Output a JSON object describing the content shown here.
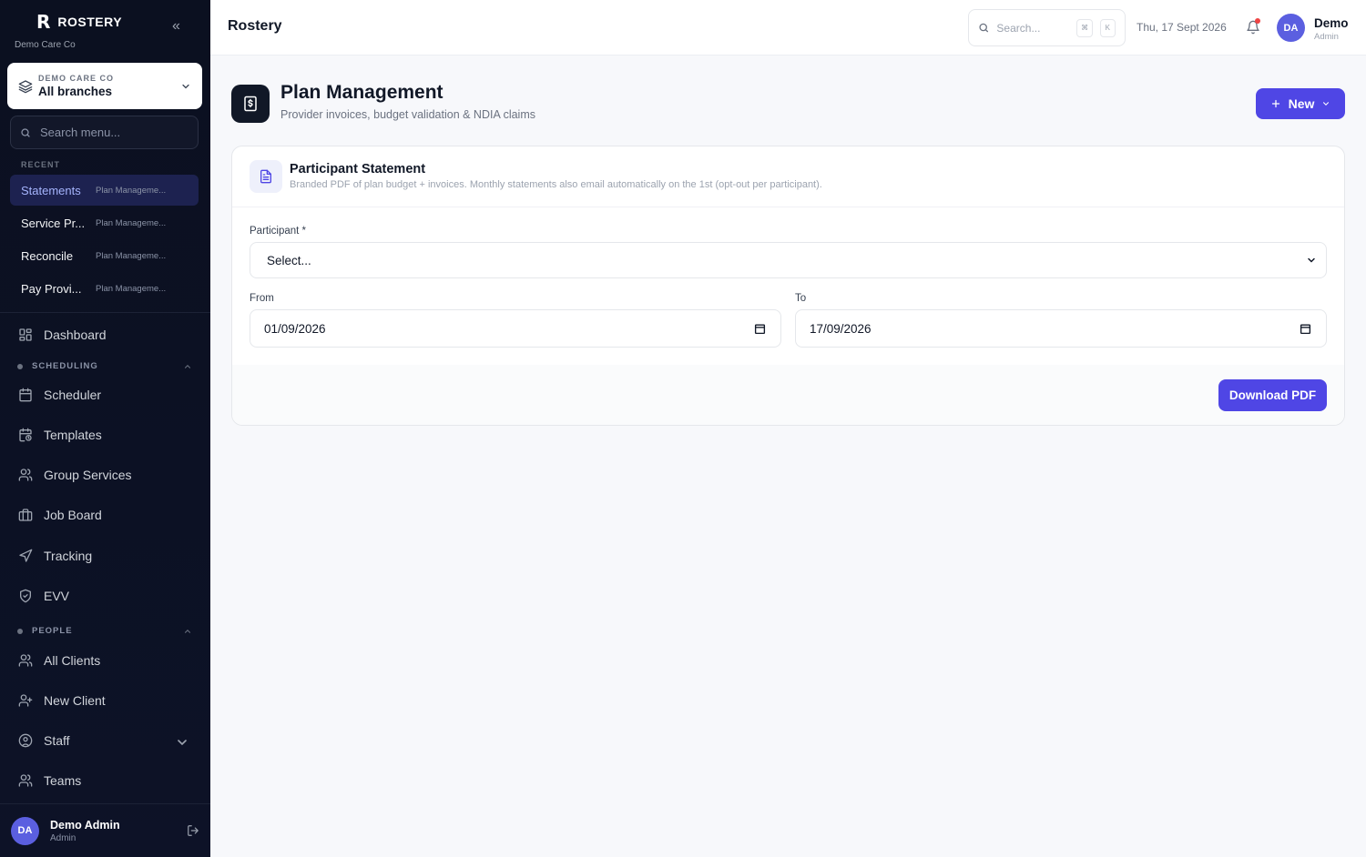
{
  "sidebar": {
    "brand": "ROSTERY",
    "brand_logo": "R",
    "collapse_icon": "«",
    "org_sub": "Demo Care Co",
    "branch": {
      "org": "DEMO CARE CO",
      "name": "All branches"
    },
    "search_placeholder": "Search menu...",
    "recent_label": "RECENT",
    "recent": [
      {
        "title": "Statements",
        "sub": "Plan Manageme..."
      },
      {
        "title": "Service Pr...",
        "sub": "Plan Manageme..."
      },
      {
        "title": "Reconcile",
        "sub": "Plan Manageme..."
      },
      {
        "title": "Pay Provi...",
        "sub": "Plan Manageme..."
      }
    ],
    "nav": {
      "dashboard": "Dashboard",
      "scheduling_label": "SCHEDULING",
      "scheduler": "Scheduler",
      "templates": "Templates",
      "group_services": "Group Services",
      "job_board": "Job Board",
      "tracking": "Tracking",
      "evv": "EVV",
      "people_label": "PEOPLE",
      "all_clients": "All Clients",
      "new_client": "New Client",
      "staff": "Staff",
      "teams": "Teams"
    },
    "user": {
      "initials": "DA",
      "name": "Demo Admin",
      "role": "Admin"
    }
  },
  "header": {
    "title": "Rostery",
    "search_placeholder": "Search...",
    "kbd_cmd": "⌘",
    "kbd_key": "K",
    "date": "Thu, 17 Sept 2026",
    "user": {
      "initials": "DA",
      "name": "Demo",
      "role": "Admin"
    }
  },
  "page": {
    "title": "Plan Management",
    "subtitle": "Provider invoices, budget validation & NDIA claims",
    "new_label": "New"
  },
  "card": {
    "title": "Participant Statement",
    "desc": "Branded PDF of plan budget + invoices. Monthly statements also email automatically on the 1st (opt-out per participant).",
    "participant_label": "Participant *",
    "participant_value": "Select...",
    "from_label": "From",
    "from_value": "01/09/2026",
    "to_label": "To",
    "to_value": "17/09/2026",
    "download_label": "Download PDF"
  },
  "colors": {
    "accent": "#4f46e5",
    "sidebar_bg": "#0b1020",
    "active_bg": "#1d2250",
    "notification": "#ef4444"
  }
}
